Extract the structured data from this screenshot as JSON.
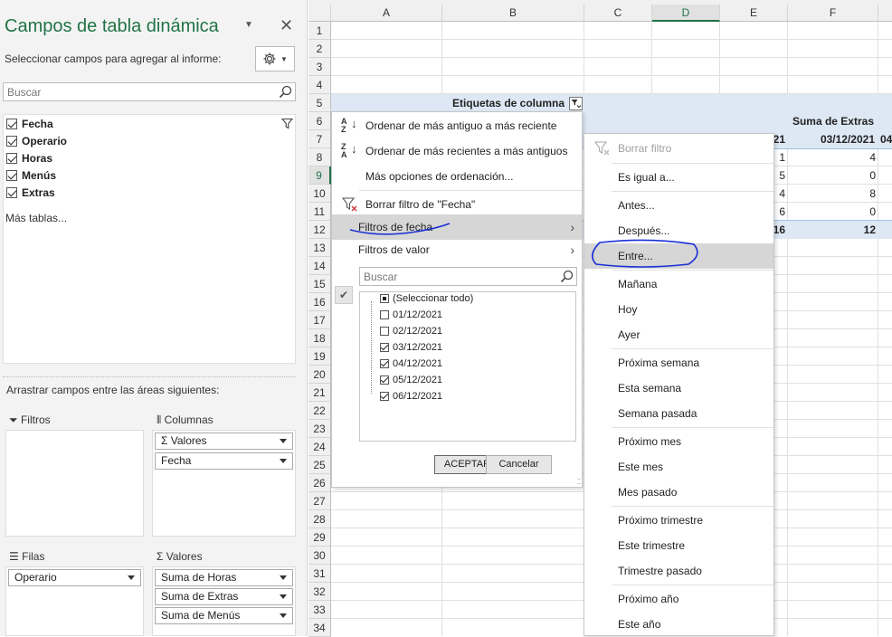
{
  "pane": {
    "title": "Campos de tabla dinámica",
    "subtitle": "Seleccionar campos para agregar al informe:",
    "search_placeholder": "Buscar",
    "fields": [
      {
        "label": "Fecha",
        "checked": true
      },
      {
        "label": "Operario",
        "checked": true
      },
      {
        "label": "Horas",
        "checked": true
      },
      {
        "label": "Menús",
        "checked": true
      },
      {
        "label": "Extras",
        "checked": true
      }
    ],
    "more_tables": "Más tablas...",
    "drag_label": "Arrastrar campos entre las áreas siguientes:",
    "areas": {
      "filters": {
        "title": "Filtros",
        "items": []
      },
      "columns": {
        "title": "Columnas",
        "items": [
          "Σ  Valores",
          "Fecha"
        ]
      },
      "rows": {
        "title": "Filas",
        "items": [
          "Operario"
        ]
      },
      "values": {
        "title": "Valores",
        "items": [
          "Suma de Horas",
          "Suma de Extras",
          "Suma de Menús"
        ]
      }
    }
  },
  "grid": {
    "columns": [
      "A",
      "B",
      "C",
      "D",
      "E",
      "F"
    ],
    "rows": [
      "1",
      "2",
      "3",
      "4",
      "5",
      "6",
      "7",
      "8",
      "9",
      "10",
      "11",
      "12",
      "13",
      "14",
      "15",
      "16",
      "17",
      "18",
      "19",
      "20",
      "21",
      "22",
      "23",
      "24",
      "25",
      "26",
      "27",
      "28",
      "29",
      "30",
      "31",
      "32",
      "33",
      "34"
    ],
    "col_labels_header": "Etiquetas de columna",
    "suma_extras": "Suma de Extras",
    "date_partial": "21",
    "date_f": "03/12/2021",
    "date_g_partial": "04",
    "e_values": [
      "1",
      "5",
      "4",
      "6",
      "16"
    ],
    "f_values": [
      "4",
      "0",
      "8",
      "0",
      "12"
    ]
  },
  "filter_menu": {
    "sort_asc": "Ordenar de más antiguo a más reciente",
    "sort_desc": "Ordenar de más recientes a más antiguos",
    "more_sort": "Más opciones de ordenación...",
    "clear_filter": "Borrar filtro de \"Fecha\"",
    "date_filters": "Filtros de fecha",
    "value_filters": "Filtros de valor",
    "search_placeholder": "Buscar",
    "items": [
      {
        "label": "(Seleccionar todo)",
        "state": "partial"
      },
      {
        "label": "01/12/2021",
        "state": "off"
      },
      {
        "label": "02/12/2021",
        "state": "off"
      },
      {
        "label": "03/12/2021",
        "state": "on"
      },
      {
        "label": "04/12/2021",
        "state": "on"
      },
      {
        "label": "05/12/2021",
        "state": "on"
      },
      {
        "label": "06/12/2021",
        "state": "on"
      }
    ],
    "ok": "ACEPTAR",
    "cancel": "Cancelar"
  },
  "date_submenu": {
    "clear": "Borrar filtro",
    "items": [
      "Es igual a...",
      "Antes...",
      "Después...",
      "Entre...",
      "Mañana",
      "Hoy",
      "Ayer",
      "Próxima semana",
      "Esta semana",
      "Semana pasada",
      "Próximo mes",
      "Este mes",
      "Mes pasado",
      "Próximo trimestre",
      "Este trimestre",
      "Trimestre pasado",
      "Próximo año",
      "Este año"
    ]
  },
  "colors": {
    "accent": "#217346",
    "annotation": "#1a2fd6",
    "pivot_header": "#dde8f4"
  }
}
